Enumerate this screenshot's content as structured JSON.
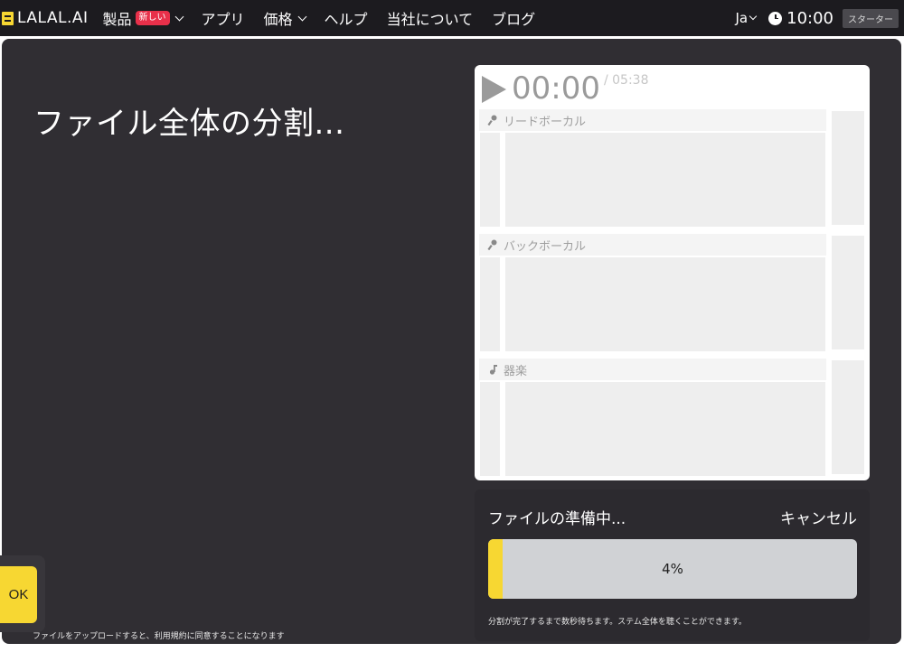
{
  "header": {
    "logo": "LALAL.AI",
    "nav": [
      {
        "label": "製品",
        "badge": "新しい",
        "dropdown": true
      },
      {
        "label": "アプリ"
      },
      {
        "label": "価格",
        "dropdown": true
      },
      {
        "label": "ヘルプ"
      },
      {
        "label": "当社について"
      },
      {
        "label": "ブログ"
      }
    ],
    "language": "Ja",
    "credits": "10:00",
    "plan": "スターター"
  },
  "main": {
    "title": "ファイル全体の分割...",
    "terms": "ファイルをアップロードすると、利用規約に同意することになります"
  },
  "player": {
    "current_time": "00:00",
    "total_time": "/ 05:38",
    "tracks": [
      {
        "name": "リードボーカル",
        "icon": "microphone-icon"
      },
      {
        "name": "バックボーカル",
        "icon": "microphone-icon"
      },
      {
        "name": "器楽",
        "icon": "music-note-icon"
      }
    ]
  },
  "progress": {
    "status": "ファイルの準備中...",
    "cancel_label": "キャンセル",
    "percent_label": "4%",
    "percent": 4,
    "note": "分割が完了するまで数秒待ちます。ステム全体を聴くことができます。"
  },
  "cookie": {
    "ok_label": "OK"
  },
  "colors": {
    "accent": "#f7d732",
    "badge": "#e8304a",
    "background": "#302e33"
  }
}
